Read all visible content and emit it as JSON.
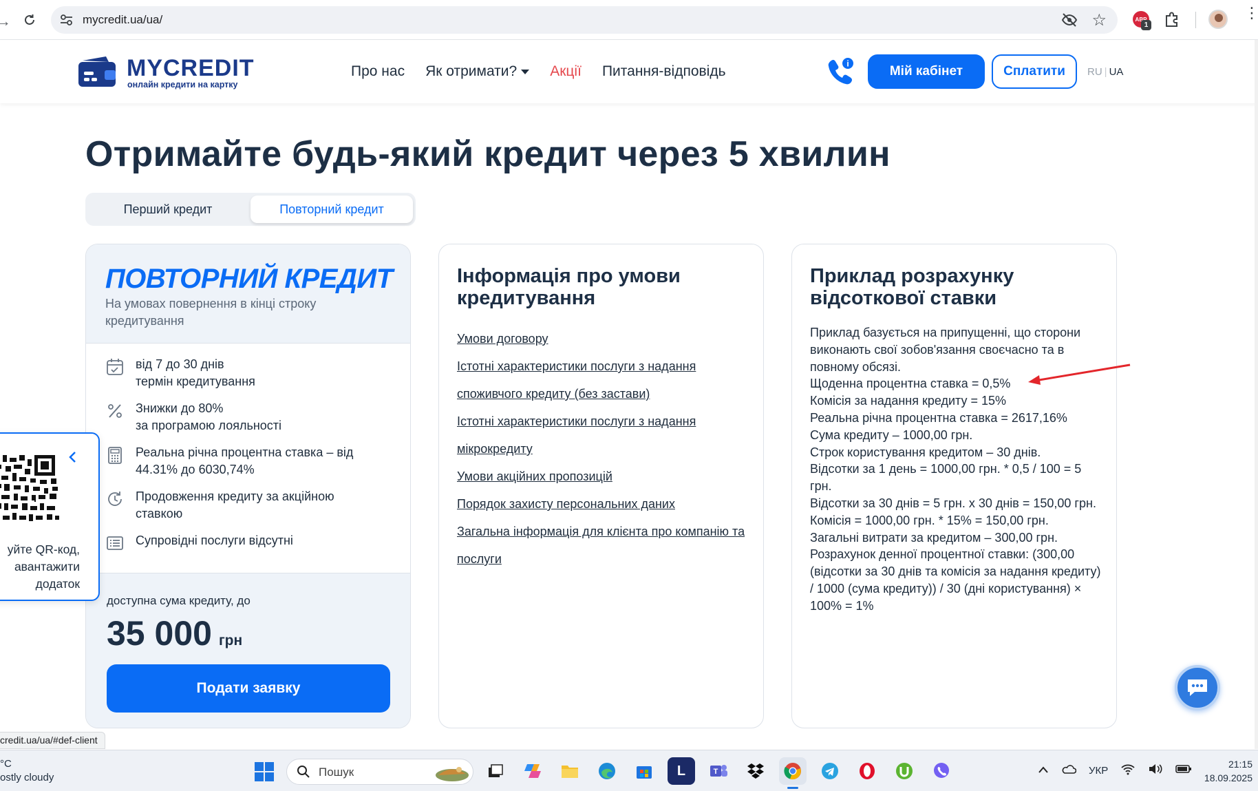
{
  "browser": {
    "url": "mycredit.ua/ua/",
    "extension_badge": "1",
    "extension_label": "ABP"
  },
  "header": {
    "logo_name": "MYCREDIT",
    "logo_tagline": "онлайн кредити на картку",
    "nav": {
      "about": "Про нас",
      "how": "Як отримати?",
      "promo": "Акції",
      "faq": "Питання-відповідь"
    },
    "cabinet_button": "Мій кабінет",
    "pay_button": "Сплатити",
    "lang_ru": "RU",
    "lang_sep": "|",
    "lang_ua": "UA"
  },
  "main": {
    "title": "Отримайте будь-який кредит через 5 хвилин",
    "tabs": [
      "Перший кредит",
      "Повторний кредит"
    ],
    "active_tab": "Повторний кредит"
  },
  "card_credit": {
    "heading": "ПОВТОРНИЙ КРЕДИТ",
    "subheading": "На умовах повернення в кінці строку кредитування",
    "features": [
      {
        "icon": "calendar-check-icon",
        "line1": "від 7 до 30 днів",
        "line2": "термін кредитування"
      },
      {
        "icon": "percent-icon",
        "line1": "Знижки до 80%",
        "line2": "за програмою лояльності"
      },
      {
        "icon": "calculator-icon",
        "line1": "Реальна річна процентна ставка – від",
        "line2": "44.31% до 6030,74%"
      },
      {
        "icon": "renew-clock-icon",
        "line1": "Продовження кредиту за акційною",
        "line2": "ставкою"
      },
      {
        "icon": "list-document-icon",
        "line1": "Супровідні послуги відсутні",
        "line2": ""
      }
    ],
    "available_label": "доступна сума кредиту, до",
    "amount": "35 000",
    "currency": "грн",
    "apply_button": "Подати заявку"
  },
  "card_info": {
    "heading": "Інформація про умови кредитування",
    "links": [
      "Умови договору",
      "Істотні характеристики послуги з надання споживчого кредиту (без застави)",
      "Істотні характеристики послуги з надання мікрокредиту",
      "Умови акційних пропозицій",
      "Порядок захисту персональних даних",
      "Загальна інформація для клієнта про компанію та послуги"
    ]
  },
  "card_example": {
    "heading": "Приклад розрахунку відсоткової ставки",
    "lines": [
      "Приклад базується на припущенні, що сторони виконають свої зобов'язання своєчасно та в повному обсязі.",
      "Щоденна процентна ставка = 0,5%",
      "Комісія за надання кредиту = 15%",
      "Реальна річна процентна ставка = 2617,16%",
      "Сума кредиту – 1000,00 грн.",
      "Строк користування кредитом – 30 днів.",
      "Відсотки за 1 день = 1000,00 грн. * 0,5 / 100 = 5 грн.",
      "Відсотки за 30 днів = 5 грн. х 30 днів = 150,00 грн.",
      "Комісія = 1000,00 грн. * 15% = 150,00 грн.",
      "Загальні витрати за кредитом – 300,00 грн.",
      "Розрахунок денної процентної ставки: (300,00 (відсотки за 30 днів та комісія за надання кредиту) / 1000 (сума кредиту)) / 30 (дні користування) × 100% = 1%"
    ]
  },
  "qr_panel": {
    "line1": "уйте QR-код,",
    "line2": "авантажити",
    "line3": "додаток"
  },
  "status_url": "credit.ua/ua/#def-client",
  "taskbar": {
    "weather_temp": "°C",
    "weather_desc": "ostly cloudy",
    "search_placeholder": "Пошук",
    "lang": "УКР",
    "time": "21:15",
    "date": "18.09.2025"
  },
  "colors": {
    "brand_blue": "#0a6cf5",
    "logo_navy": "#1b3a8a",
    "promo_red": "#e5484d",
    "heading_dark": "#1d2f45",
    "annotation_arrow": "#e3262b"
  }
}
